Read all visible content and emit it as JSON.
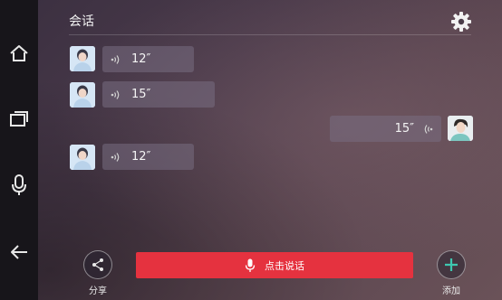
{
  "header": {
    "title": "会话"
  },
  "sidebar": {
    "items": [
      {
        "icon": "home-icon"
      },
      {
        "icon": "windows-icon"
      },
      {
        "icon": "microphone-icon"
      },
      {
        "icon": "back-arrow-icon"
      }
    ]
  },
  "messages": [
    {
      "side": "left",
      "duration": "12″"
    },
    {
      "side": "left",
      "duration": "15″"
    },
    {
      "side": "right",
      "duration": "15″"
    },
    {
      "side": "left",
      "duration": "12″"
    }
  ],
  "bottom": {
    "share_label": "分享",
    "talk_label": "点击说话",
    "add_label": "添加"
  },
  "colors": {
    "accent": "#e5323f",
    "sidebar": "#17151a",
    "add_icon": "#3ec7b0"
  }
}
